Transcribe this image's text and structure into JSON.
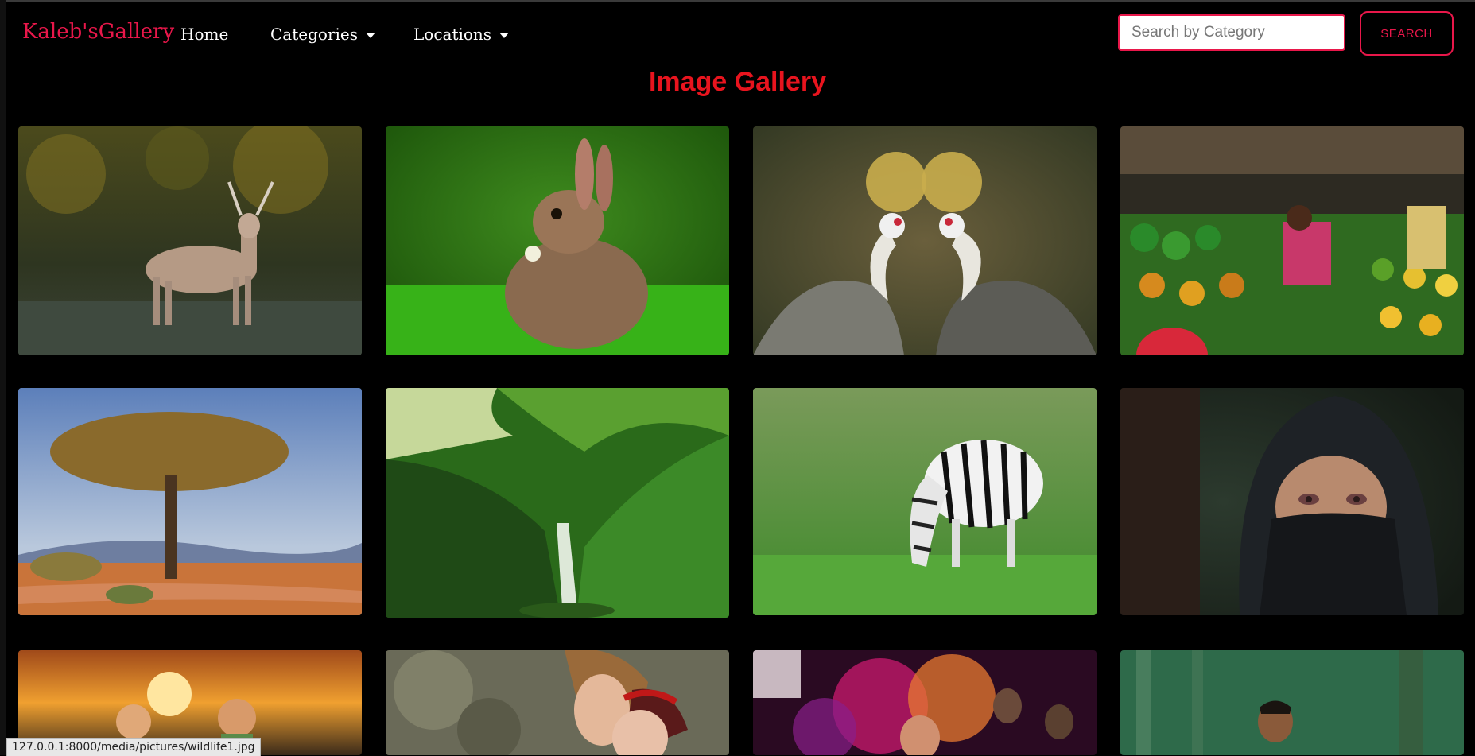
{
  "navbar": {
    "brand": "Kaleb'sGallery",
    "home": "Home",
    "categories": "Categories",
    "locations": "Locations",
    "search_placeholder": "Search by Category",
    "search_button": "SEARCH"
  },
  "gallery": {
    "title": "Image Gallery"
  },
  "status_bar": {
    "url": "127.0.0.1:8000/media/pictures/wildlife1.jpg"
  },
  "colors": {
    "accent": "#e8174a",
    "title": "#e8141e",
    "background": "#000000"
  }
}
